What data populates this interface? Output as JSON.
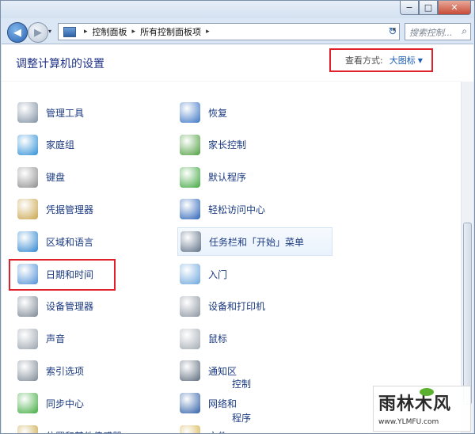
{
  "window": {
    "minimize_glyph": "−",
    "maximize_glyph": "□",
    "close_glyph": "✕"
  },
  "nav": {
    "back_glyph": "◀",
    "forward_glyph": "▶",
    "history_glyph": "▾",
    "breadcrumbs": [
      "控制面板",
      "所有控制面板项"
    ],
    "separator_glyph": "▸",
    "dropdown_glyph": "▾",
    "refresh_glyph": "↻",
    "search_placeholder": "搜索控制...",
    "search_icon_glyph": "⌕"
  },
  "header": {
    "title": "调整计算机的设置",
    "view_by_label": "查看方式:",
    "view_by_value": "大图标",
    "view_by_arrow": "▼"
  },
  "items": [
    {
      "label": "管理工具",
      "icon": "admin-tools-icon",
      "color": "#7f8fa3"
    },
    {
      "label": "恢复",
      "icon": "recovery-icon",
      "color": "#3a74c4"
    },
    {
      "label": "家庭组",
      "icon": "homegroup-icon",
      "color": "#2d8fd6"
    },
    {
      "label": "家长控制",
      "icon": "parental-controls-icon",
      "color": "#4d9e3e"
    },
    {
      "label": "键盘",
      "icon": "keyboard-icon",
      "color": "#8d8d8d"
    },
    {
      "label": "默认程序",
      "icon": "default-programs-icon",
      "color": "#3fa63f"
    },
    {
      "label": "凭据管理器",
      "icon": "credential-manager-icon",
      "color": "#c9a44a"
    },
    {
      "label": "轻松访问中心",
      "icon": "ease-of-access-icon",
      "color": "#2a62b8"
    },
    {
      "label": "区域和语言",
      "icon": "region-language-icon",
      "color": "#2f86d0"
    },
    {
      "label": "任务栏和「开始」菜单",
      "icon": "taskbar-start-menu-icon",
      "color": "#5d6f86"
    },
    {
      "label": "日期和时间",
      "icon": "date-time-icon",
      "color": "#4e8fd6"
    },
    {
      "label": "入门",
      "icon": "getting-started-icon",
      "color": "#6aa5dc"
    },
    {
      "label": "设备管理器",
      "icon": "device-manager-icon",
      "color": "#7c8793"
    },
    {
      "label": "设备和打印机",
      "icon": "devices-printers-icon",
      "color": "#8a949f"
    },
    {
      "label": "声音",
      "icon": "sound-icon",
      "color": "#9aa3ad"
    },
    {
      "label": "鼠标",
      "icon": "mouse-icon",
      "color": "#a3abb4"
    },
    {
      "label": "索引选项",
      "icon": "indexing-options-icon",
      "color": "#7e8a96"
    },
    {
      "label": "通知区",
      "icon": "notification-area-icon",
      "color": "#5c6b7c"
    },
    {
      "label": "同步中心",
      "icon": "sync-center-icon",
      "color": "#3faa3f"
    },
    {
      "label": "网络和",
      "icon": "network-icon",
      "color": "#2d5ea6"
    },
    {
      "label": "位置和其他传感器",
      "icon": "location-sensors-icon",
      "color": "#c7a23f"
    },
    {
      "label": "文件",
      "icon": "folder-options-icon",
      "color": "#d4b04a"
    }
  ],
  "overlay_fragments": [
    "控制",
    "程序"
  ],
  "watermark": {
    "title": "雨林木风",
    "url": "www.YLMFU.com"
  }
}
